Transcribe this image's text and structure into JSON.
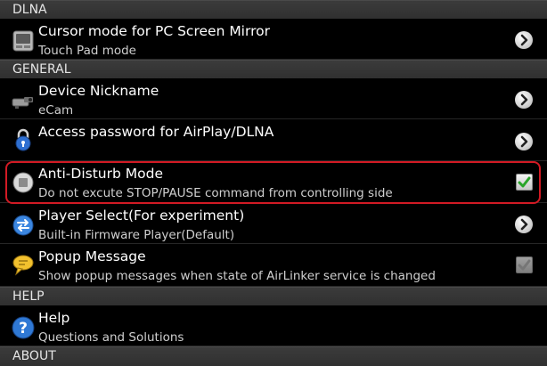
{
  "sections": {
    "dlna": "DLNA",
    "general": "GENERAL",
    "help": "HELP",
    "about": "ABOUT"
  },
  "items": {
    "cursor_mode": {
      "title": "Cursor mode for PC Screen Mirror",
      "subtitle": "Touch Pad mode",
      "icon": "touchpad-icon",
      "control": "chevron"
    },
    "device_nickname": {
      "title": "Device Nickname",
      "subtitle": "eCam",
      "icon": "camera-icon",
      "control": "chevron"
    },
    "access_password": {
      "title": "Access password for AirPlay/DLNA",
      "subtitle": "",
      "icon": "lock-icon",
      "control": "chevron"
    },
    "anti_disturb": {
      "title": "Anti-Disturb Mode",
      "subtitle": "Do not excute STOP/PAUSE command from controlling side",
      "icon": "stop-icon",
      "control": "checkbox",
      "checked": true
    },
    "player_select": {
      "title": "Player Select(For experiment)",
      "subtitle": "Built-in Firmware Player(Default)",
      "icon": "swap-icon",
      "control": "chevron"
    },
    "popup_message": {
      "title": "Popup Message",
      "subtitle": "Show popup messages when state of AirLinker service is changed",
      "icon": "speech-bubble-icon",
      "control": "checkbox",
      "checked": true,
      "disabled": true
    },
    "help": {
      "title": "Help",
      "subtitle": "Questions and Solutions",
      "icon": "question-icon"
    }
  },
  "colors": {
    "highlight": "#d21a24",
    "check": "#2aa52a",
    "section_bg": "#353535"
  }
}
